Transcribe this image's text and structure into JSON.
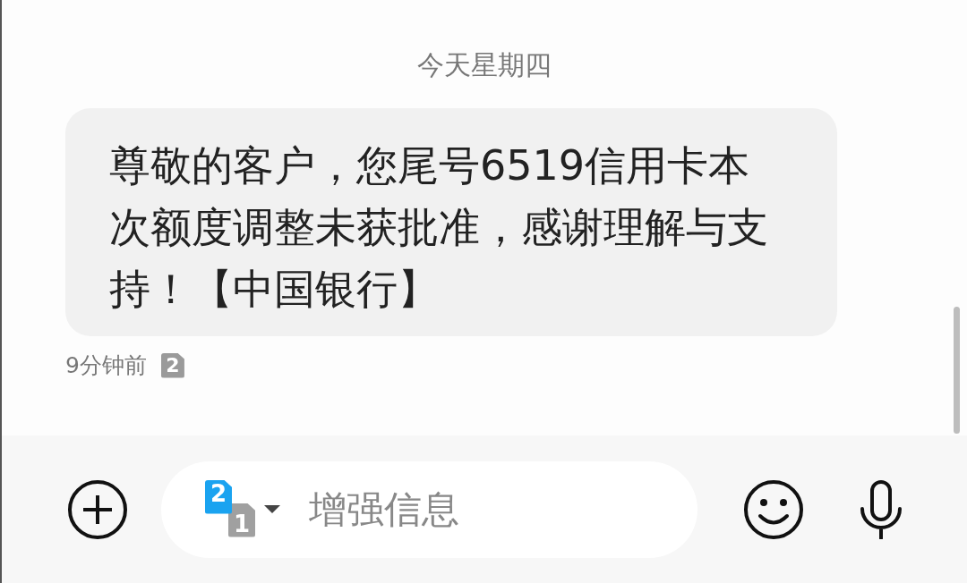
{
  "date_header": "今天星期四",
  "messages": [
    {
      "text": "尊敬的客户，您尾号6519信用卡本次额度调整未获批准，感谢理解与支持！【中国银行】",
      "time": "9分钟前",
      "sim": "2"
    }
  ],
  "compose": {
    "sim_selector": {
      "front": "2",
      "back": "1"
    },
    "placeholder": "增强信息"
  }
}
